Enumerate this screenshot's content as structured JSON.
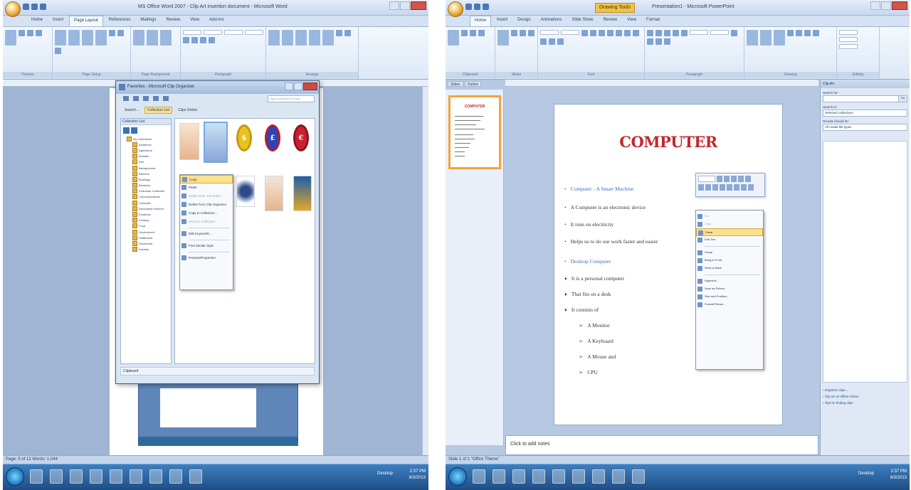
{
  "left": {
    "window_title": "MS Office Word 2007 - Clip Art insertion document - Microsoft Word",
    "tabs": [
      "Home",
      "Insert",
      "Page Layout",
      "References",
      "Mailings",
      "Review",
      "View",
      "Add-Ins"
    ],
    "active_tab_index": 2,
    "ribbon_groups": [
      "Themes",
      "Page Setup",
      "Page Background",
      "Paragraph",
      "Arrange"
    ],
    "dialog": {
      "title": "Favorites - Microsoft Clip Organizer",
      "search_placeholder": "Type a question for help",
      "toolbar": [
        "Search...",
        "Collection List",
        "Clips Online"
      ],
      "tree_header": "Collection List",
      "tree_items": [
        {
          "label": "My Collections",
          "level": 0
        },
        {
          "label": "Academic",
          "level": 1
        },
        {
          "label": "Agriculture",
          "level": 1
        },
        {
          "label": "Animals",
          "level": 1
        },
        {
          "label": "Arts",
          "level": 1
        },
        {
          "label": "Backgrounds",
          "level": 1
        },
        {
          "label": "Banners",
          "level": 1
        },
        {
          "label": "Buildings",
          "level": 1
        },
        {
          "label": "Business",
          "level": 1
        },
        {
          "label": "Character Collection",
          "level": 1
        },
        {
          "label": "Communications",
          "level": 1
        },
        {
          "label": "Concepts",
          "level": 1
        },
        {
          "label": "Decorative Element",
          "level": 1
        },
        {
          "label": "Emotions",
          "level": 1
        },
        {
          "label": "Fantasy",
          "level": 1
        },
        {
          "label": "Food",
          "level": 1
        },
        {
          "label": "Government",
          "level": 1
        },
        {
          "label": "Healthcare",
          "level": 1
        },
        {
          "label": "Household",
          "level": 1
        },
        {
          "label": "Industry",
          "level": 1
        }
      ],
      "context_menu": [
        {
          "label": "Copy",
          "highlight": true
        },
        {
          "label": "Paste",
          "highlight": false
        },
        {
          "label": "Delete from \"Favorites\"",
          "dim": true
        },
        {
          "label": "Delete from Clip Organizer"
        },
        {
          "label": "Copy to Collection..."
        },
        {
          "label": "Move to Collection...",
          "dim": true
        },
        {
          "sep": true
        },
        {
          "label": "Edit Keywords..."
        },
        {
          "sep": true
        },
        {
          "label": "Find Similar Style"
        },
        {
          "sep": true
        },
        {
          "label": "Preview/Properties"
        }
      ],
      "status": "Clipboard"
    },
    "status_bar": "Page: 5 of 12    Words: 1,044",
    "coin_symbols": [
      "$",
      "£",
      "€",
      "¥"
    ]
  },
  "right": {
    "window_title": "Presentation1 - Microsoft PowerPoint",
    "tools_badge": "Drawing Tools",
    "tabs": [
      "Home",
      "Insert",
      "Design",
      "Animations",
      "Slide Show",
      "Review",
      "View",
      "Format"
    ],
    "active_tab_index": 0,
    "ribbon_groups": [
      "Clipboard",
      "Slides",
      "Font",
      "Paragraph",
      "Drawing",
      "Editing"
    ],
    "pane_tabs": [
      "Slides",
      "Outline"
    ],
    "slide": {
      "title": "COMPUTER",
      "bullets": [
        {
          "text": "Computer - A Smart Machine",
          "style": "heading",
          "marker": "•"
        },
        {
          "text": "A Computer is an electronic device",
          "style": "normal",
          "marker": "•"
        },
        {
          "text": "It runs on electricity",
          "style": "normal",
          "marker": "•"
        },
        {
          "text": "Helps us to do our work faster and easier",
          "style": "normal",
          "marker": "•"
        },
        {
          "text": "Desktop Computer",
          "style": "heading",
          "marker": "•"
        },
        {
          "text": "It is a personal computer",
          "style": "normal",
          "marker": "♦"
        },
        {
          "text": "That fits on a desk",
          "style": "normal",
          "marker": "♦"
        },
        {
          "text": "It consists of",
          "style": "normal",
          "marker": "♦"
        },
        {
          "text": "A Monitor",
          "style": "sub",
          "marker": "➢"
        },
        {
          "text": "A Keyboard",
          "style": "sub",
          "marker": "➢"
        },
        {
          "text": "A Mouse and",
          "style": "sub",
          "marker": "➢"
        },
        {
          "text": "CPU",
          "style": "sub",
          "marker": "➢"
        }
      ]
    },
    "context_menu": [
      {
        "label": "Cut",
        "dim": true
      },
      {
        "label": "Copy",
        "dim": true
      },
      {
        "label": "Paste",
        "highlight": true
      },
      {
        "label": "Edit Text"
      },
      {
        "sep": true
      },
      {
        "label": "Group"
      },
      {
        "label": "Bring to Front"
      },
      {
        "label": "Send to Back"
      },
      {
        "sep": true
      },
      {
        "label": "Hyperlink..."
      },
      {
        "label": "Save as Picture..."
      },
      {
        "label": "Size and Position..."
      },
      {
        "label": "Format Picture..."
      }
    ],
    "notes_placeholder": "Click to add notes",
    "task_pane": {
      "title": "Clip Art",
      "search_for_label": "Search for:",
      "search_value": "",
      "go_label": "Go",
      "search_in_label": "Search in:",
      "search_in_value": "Selected collections",
      "results_label": "Results should be:",
      "results_value": "All media file types",
      "links": [
        "Organize clips...",
        "Clip art on Office Online",
        "Tips for finding clips"
      ]
    },
    "status_bar": "Slide 1 of 1    \"Office Theme\""
  },
  "taskbar": {
    "tray_name": "Desktop",
    "time": "2:37 PM",
    "date": "8/3/2013"
  },
  "colors": {
    "ribbon_bg": "#dce8f6",
    "highlight": "#fbe08e",
    "slide_title": "#c1272d",
    "slide_heading": "#3a6fb8",
    "taskbar": "#1f4d86"
  }
}
